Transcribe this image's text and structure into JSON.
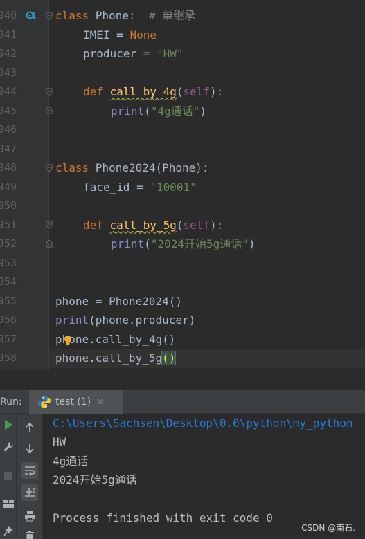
{
  "editor": {
    "line_numbers": [
      "940",
      "941",
      "942",
      "943",
      "944",
      "945",
      "946",
      "947",
      "948",
      "949",
      "950",
      "951",
      "952",
      "953",
      "954",
      "955",
      "956",
      "957",
      "958"
    ],
    "l940": {
      "kw": "class",
      "name": " Phone:  ",
      "comment": "# 单继承"
    },
    "l941": {
      "a": "IMEI = ",
      "b": "None"
    },
    "l942": {
      "a": "producer = ",
      "b": "\"HW\""
    },
    "l944": {
      "kw": "def ",
      "fn": "call_by_4g",
      "p1": "(",
      "self": "self",
      "p2": "):"
    },
    "l945": {
      "builtin": "print",
      "p1": "(",
      "str": "\"4g通话\"",
      "p2": ")"
    },
    "l948": {
      "kw": "class",
      "name": " Phone2024(Phone):"
    },
    "l949": {
      "a": "face_id = ",
      "b": "\"10001\""
    },
    "l951": {
      "kw": "def ",
      "fn": "call_by_5g",
      "p1": "(",
      "self": "self",
      "p2": "):"
    },
    "l952": {
      "builtin": "print",
      "p1": "(",
      "str": "\"2024开始5g通话\"",
      "p2": ")"
    },
    "l955": {
      "text": "phone = Phone2024()"
    },
    "l956": {
      "builtin": "print",
      "rest": "(phone.producer)"
    },
    "l957": {
      "a": "ph",
      "b": "one.call_by_4g()"
    },
    "l958": {
      "a": "phone.call_by_5g",
      "b": "()"
    }
  },
  "run": {
    "label": "Run:",
    "tab_label": "test (1)",
    "tab_close": "×"
  },
  "console": {
    "path": "C:\\Users\\Sachsen\\Desktop\\0.0\\python\\my_python",
    "lines": [
      "HW",
      "4g通话",
      "2024开始5g通话"
    ],
    "exit": "Process finished with exit code 0"
  },
  "watermark": "CSDN @南石.",
  "colors": {
    "keyword": "#cc7832",
    "string": "#6a8759",
    "function": "#ffc66d",
    "builtin": "#8888c6",
    "self": "#94558d",
    "link": "#287bde",
    "run_green": "#499c54"
  },
  "icons": [
    "breakpoint-override-icon",
    "python-icon",
    "run-icon",
    "wrench-icon",
    "stop-icon",
    "layout-icon",
    "pin-icon",
    "up-arrow-icon",
    "down-arrow-icon",
    "soft-wrap-icon",
    "scroll-to-end-icon",
    "print-icon",
    "trash-icon",
    "bulb-icon"
  ]
}
